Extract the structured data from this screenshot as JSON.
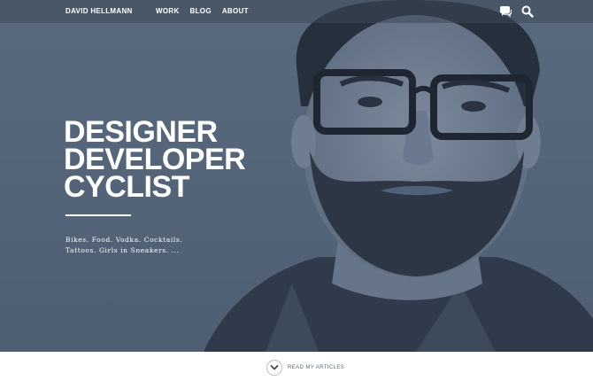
{
  "header": {
    "brand": "DAVID HELLMANN",
    "nav": [
      {
        "label": "WORK"
      },
      {
        "label": "BLOG"
      },
      {
        "label": "ABOUT"
      }
    ],
    "icons": [
      "chat-icon",
      "search-icon"
    ]
  },
  "hero": {
    "headline": [
      "DESIGNER",
      "DEVELOPER",
      "CYCLIST"
    ],
    "tagline": [
      "Bikes. Food. Vodka. Cocktails.",
      "Tattoos. Girls in Sneakers. ..."
    ]
  },
  "footer": {
    "cta_label": "READ MY ARTICLES",
    "cta_icon": "chevron-down-icon"
  },
  "colors": {
    "hero_tint": "#56667a",
    "text": "#ffffff",
    "cta_text": "#5b6675"
  }
}
